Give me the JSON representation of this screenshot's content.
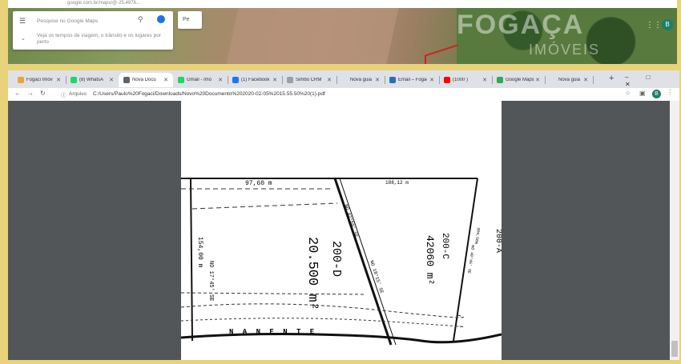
{
  "background_window": {
    "address": "google.com.br/maps/@-25.4976...",
    "maps_search_placeholder": "Pesquise no Google Maps",
    "maps_hint": "Veja os tempos de viagem, o trânsito e os lugares por perto",
    "chip_label": "Pe",
    "account_initial": "B",
    "watermark": "FOGAÇA",
    "watermark_sub": "IMÓVEIS"
  },
  "tabs": [
    {
      "label": "Fogaci Imóv",
      "color": "#e8a33d"
    },
    {
      "label": "(8) WhatsA",
      "color": "#25d366"
    },
    {
      "label": "Nova Docu",
      "color": "#5f6368"
    },
    {
      "label": "Gmail - Imó",
      "color": "#25d366"
    },
    {
      "label": "(1) Facebook",
      "color": "#1877f2"
    },
    {
      "label": "Simbo CRM",
      "color": "#9aa0a6"
    },
    {
      "label": "Nova guia",
      "color": "#dee1e6"
    },
    {
      "label": "Email – Fogaç",
      "color": "#2a6ebb"
    },
    {
      "label": "(1000 ) ",
      "color": "#ff0000"
    },
    {
      "label": "Google Maps",
      "color": "#34a853"
    },
    {
      "label": "Nova guia",
      "color": "#dee1e6"
    }
  ],
  "toolbar": {
    "site_label": "Arquivo",
    "url": "C:/Users/Paulo%20Fogaci/Downloads/Novo%20Documento%202020-02-05%2015.55.50%20(1).pdf",
    "account_initial": "B"
  },
  "document": {
    "top_measure": "97,60 m",
    "top_right_measure": "188,12 m",
    "left_measure": "154,00 m",
    "left_bearing": "NO 17°45' SE",
    "diag_bearing_a": "NO 42°50' SE",
    "diag_bearing_b": "NO 18°15' SE",
    "right_measure": "309,50m",
    "right_bearing": "NO 40°45' SE",
    "lot_d_id": "200-D",
    "lot_d_area": "20.500 m²",
    "lot_c_id": "200-C",
    "lot_c_area": "42060 m²",
    "lot_a_id": "200-A",
    "bottom_text": "N A N E N T E"
  }
}
